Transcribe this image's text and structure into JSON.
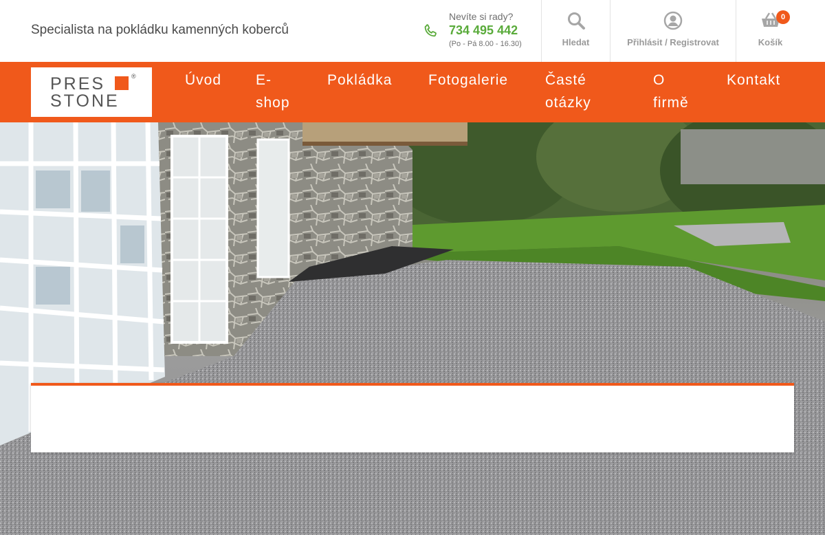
{
  "header": {
    "tagline": "Specialista na pokládku kamenných koberců",
    "phone": {
      "question": "Nevíte si rady?",
      "number": "734 495 442",
      "hours": "(Po - Pá 8.00 - 16.30)",
      "icon": "phone-icon"
    },
    "actions": {
      "search_label": "Hledat",
      "search_icon": "search-icon",
      "login_label": "Přihlásit / Registrovat",
      "login_icon": "user-icon",
      "cart_label": "Košík",
      "cart_icon": "basket-icon",
      "cart_count": "0"
    }
  },
  "logo": {
    "line1": "PRES",
    "line2": "STONE",
    "registered": "®"
  },
  "nav": {
    "items": [
      {
        "line1": "Úvod",
        "line2": ""
      },
      {
        "line1": "E-",
        "line2": "shop"
      },
      {
        "line1": "Pokládka",
        "line2": ""
      },
      {
        "line1": "Fotogalerie",
        "line2": ""
      },
      {
        "line1": "Časté",
        "line2": "otázky"
      },
      {
        "line1": "O",
        "line2": "firmě"
      },
      {
        "line1": "Kontakt",
        "line2": ""
      }
    ]
  },
  "colors": {
    "brand_orange": "#f0591b",
    "phone_green": "#5aab3b",
    "muted_gray": "#9a9a9a"
  }
}
